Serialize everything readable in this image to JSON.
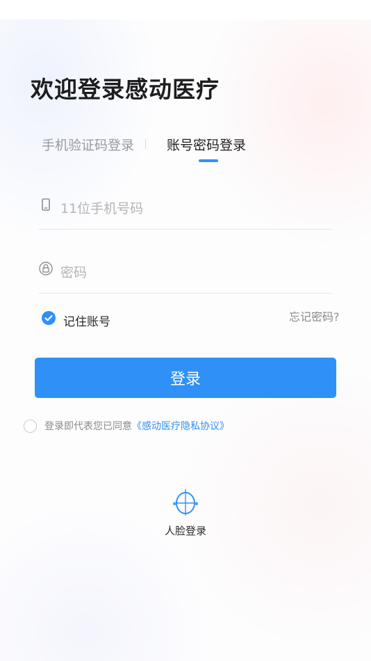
{
  "page": {
    "title": "欢迎登录感动医疗"
  },
  "tabs": {
    "sms_label": "手机验证码登录",
    "password_label": "账号密码登录",
    "active": "password"
  },
  "form": {
    "phone": {
      "placeholder": "11位手机号码",
      "value": "",
      "icon": "phone-icon"
    },
    "password": {
      "placeholder": "密码",
      "value": "",
      "icon": "lock-icon"
    },
    "remember": {
      "label": "记住账号",
      "checked": true
    },
    "forgot_label": "忘记密码?",
    "login_label": "登录"
  },
  "agreement": {
    "text": "登录即代表您已同意",
    "link": "《感动医疗隐私协议》",
    "checked": false
  },
  "face_login": {
    "label": "人脸登录",
    "icon": "face-scan-icon"
  },
  "colors": {
    "accent": "#2f91f7",
    "title": "#1d1d1f",
    "muted": "#9a9a9e"
  }
}
